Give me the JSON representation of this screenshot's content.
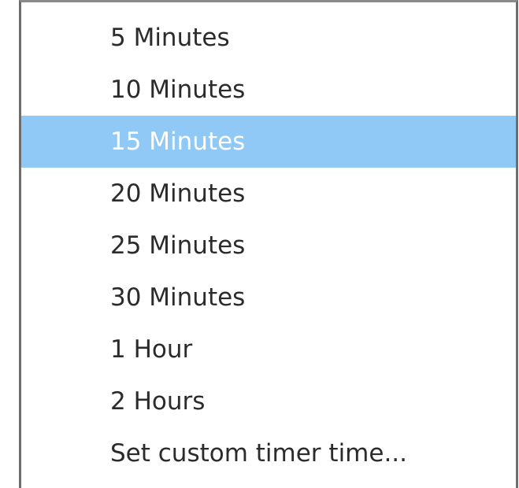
{
  "menu": {
    "items": [
      {
        "label": "5 Minutes",
        "selected": false
      },
      {
        "label": "10 Minutes",
        "selected": false
      },
      {
        "label": "15 Minutes",
        "selected": true
      },
      {
        "label": "20 Minutes",
        "selected": false
      },
      {
        "label": "25 Minutes",
        "selected": false
      },
      {
        "label": "30 Minutes",
        "selected": false
      },
      {
        "label": "1 Hour",
        "selected": false
      },
      {
        "label": "2 Hours",
        "selected": false
      },
      {
        "label": "Set custom timer time...",
        "selected": false
      }
    ]
  },
  "colors": {
    "selection": "#90c8f6",
    "text": "#2b2b2b",
    "selected_text": "#ffffff",
    "border": "#6d6d6d"
  }
}
